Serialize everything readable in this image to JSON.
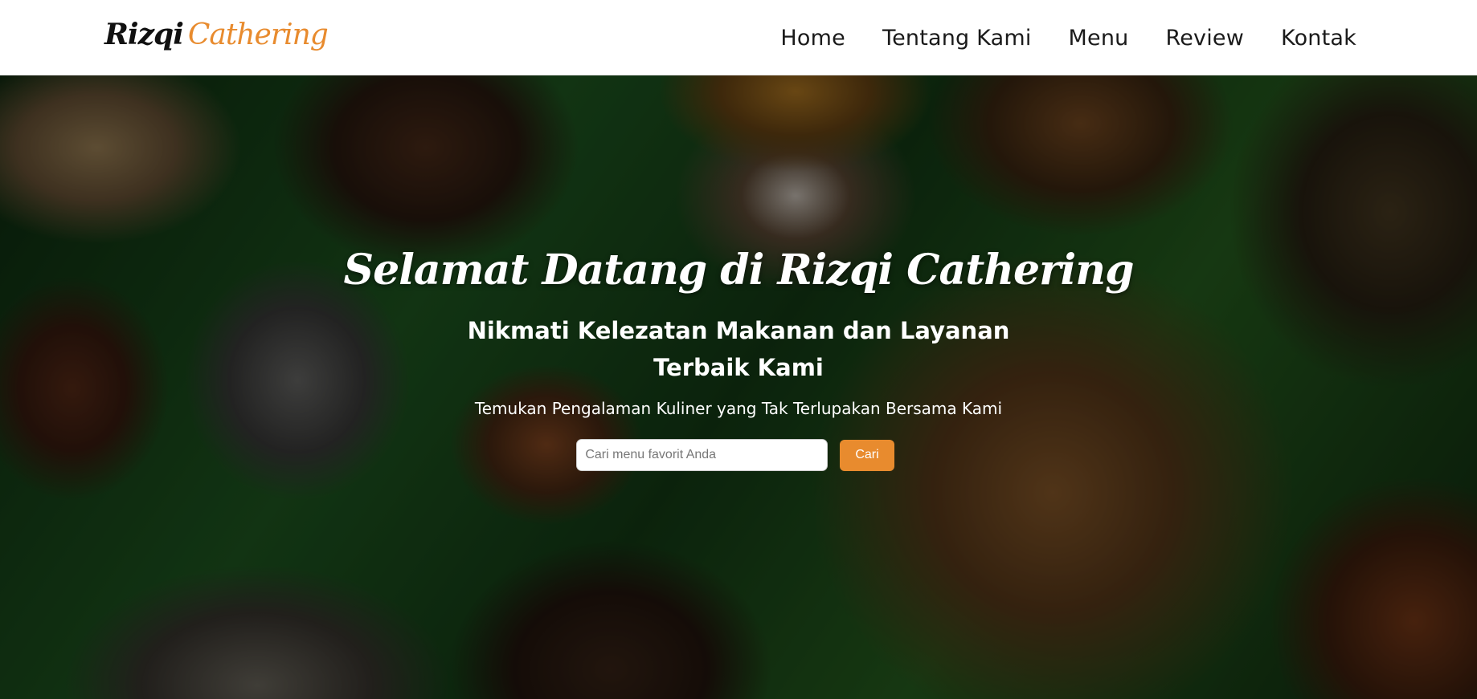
{
  "brand": {
    "logo_first": "Rizqi",
    "logo_second": "Cathering"
  },
  "nav": {
    "items": [
      {
        "label": "Home"
      },
      {
        "label": "Tentang Kami"
      },
      {
        "label": "Menu"
      },
      {
        "label": "Review"
      },
      {
        "label": "Kontak"
      }
    ]
  },
  "hero": {
    "title": "Selamat Datang di Rizqi Cathering",
    "subtitle": "Nikmati Kelezatan Makanan dan Layanan Terbaik Kami",
    "tagline": "Temukan Pengalaman Kuliner yang Tak Terlupakan Bersama Kami",
    "search": {
      "placeholder": "Cari menu favorit Anda",
      "value": "",
      "button_label": "Cari"
    },
    "background_image": "food-spread-on-banana-leaves"
  },
  "colors": {
    "accent": "#e88b2e",
    "navbar_bg": "#ffffff",
    "text_dark": "#1a1a1a"
  }
}
